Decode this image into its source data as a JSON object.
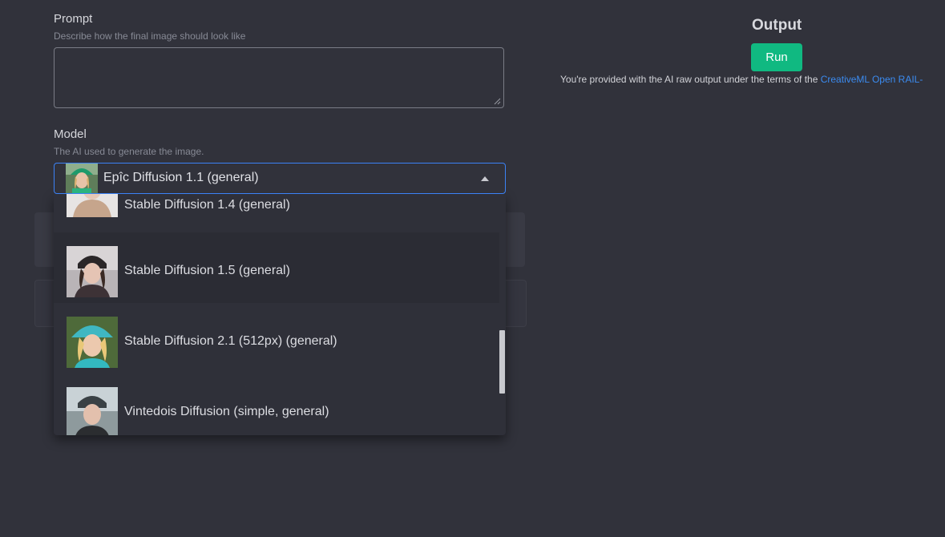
{
  "prompt": {
    "label": "Prompt",
    "help": "Describe how the final image should look like",
    "value": ""
  },
  "model": {
    "label": "Model",
    "help": "The AI used to generate the image.",
    "selected": "Epîc Diffusion 1.1 (general)",
    "options": [
      {
        "label": "Stable Diffusion 1.4 (general)"
      },
      {
        "label": "Stable Diffusion 1.5 (general)"
      },
      {
        "label": "Stable Diffusion 2.1 (512px) (general)"
      },
      {
        "label": "Vintedois Diffusion (simple, general)"
      }
    ],
    "scroll_fraction": 0.55
  },
  "output": {
    "title": "Output",
    "run_label": "Run",
    "terms_text": "You're provided with the AI raw output under the terms of the ",
    "terms_link": "CreativeML Open RAIL-"
  },
  "colors": {
    "background": "#31323b",
    "accent_green": "#10b981",
    "focus_blue": "#3b82f6",
    "link_blue": "#3b8bf0"
  }
}
